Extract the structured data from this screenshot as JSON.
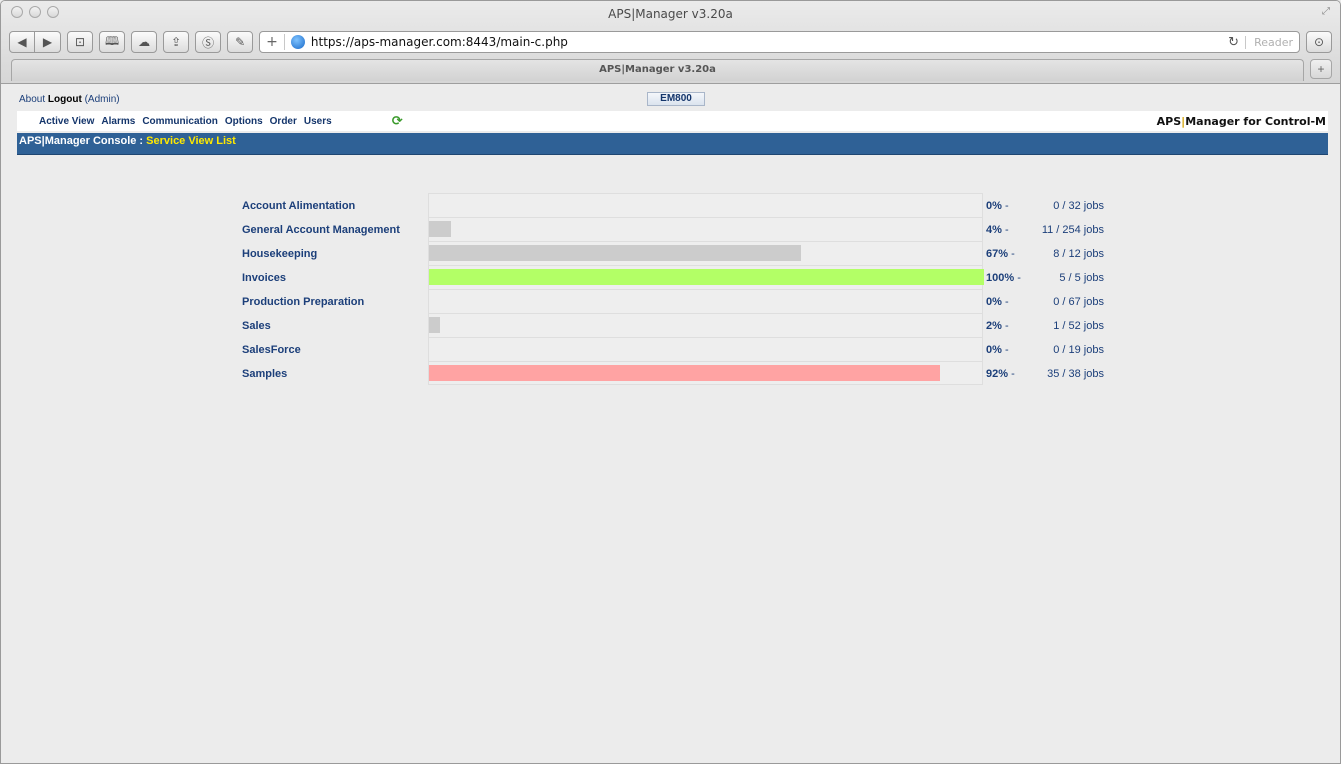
{
  "browser": {
    "window_title": "APS|Manager v3.20a",
    "tab_title": "APS|Manager v3.20a",
    "url": "https://aps-manager.com:8443/main-c.php",
    "reader_label": "Reader",
    "icons": [
      "back-icon",
      "forward-icon",
      "topsites-icon",
      "bookmarks-icon",
      "icloud-icon",
      "share-icon",
      "skype-icon",
      "tools-icon",
      "add-icon",
      "globe-icon",
      "reload-icon",
      "downloads-icon"
    ]
  },
  "header": {
    "about": "About",
    "logout": "Logout",
    "user": "(Admin)",
    "server_badge": "EM800"
  },
  "menu": {
    "items": [
      "Active View",
      "Alarms",
      "Communication",
      "Options",
      "Order",
      "Users"
    ],
    "brand_left": "APS",
    "brand_sep": "|",
    "brand_right": "Manager for Control-M"
  },
  "console": {
    "prefix": "APS|Manager Console : ",
    "page": "Service View List"
  },
  "services": [
    {
      "name": "Account Alimentation",
      "pct_label": "0%",
      "dash": " -",
      "jobs": "0 / 32 jobs",
      "fill": 0,
      "color": "#cccccc"
    },
    {
      "name": "General Account Management",
      "pct_label": "4%",
      "dash": " -",
      "jobs": "11 / 254 jobs",
      "fill": 4,
      "color": "#cccccc"
    },
    {
      "name": "Housekeeping",
      "pct_label": "67%",
      "dash": " -",
      "jobs": "8 / 12 jobs",
      "fill": 67,
      "color": "#cccccc"
    },
    {
      "name": "Invoices",
      "pct_label": "100%",
      "dash": " -",
      "jobs": "5 / 5 jobs",
      "fill": 100,
      "color": "#b3ff66"
    },
    {
      "name": "Production Preparation",
      "pct_label": "0%",
      "dash": " -",
      "jobs": "0 / 67 jobs",
      "fill": 0,
      "color": "#cccccc"
    },
    {
      "name": "Sales",
      "pct_label": "2%",
      "dash": " -",
      "jobs": "1 / 52 jobs",
      "fill": 2,
      "color": "#cccccc"
    },
    {
      "name": "SalesForce",
      "pct_label": "0%",
      "dash": " -",
      "jobs": "0 / 19 jobs",
      "fill": 0,
      "color": "#cccccc"
    },
    {
      "name": "Samples",
      "pct_label": "92%",
      "dash": " -",
      "jobs": "35 / 38 jobs",
      "fill": 92,
      "color": "#ffa3a3"
    }
  ]
}
